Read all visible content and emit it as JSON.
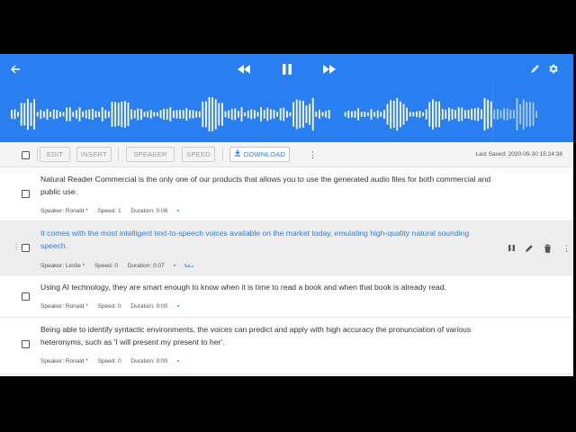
{
  "colors": {
    "header": "#2a7ff0",
    "link_text": "#2a7ff0",
    "accent_dot": "#4caf50",
    "cursor": "#e8524a"
  },
  "header": {
    "back_icon": "arrow-left-icon",
    "rewind_icon": "rewind-icon",
    "pause_icon": "pause-icon",
    "forward_icon": "fast-forward-icon",
    "edit_icon": "pencil-icon",
    "settings_icon": "gear-icon"
  },
  "toolbar": {
    "edit_label": "EDIT",
    "insert_label": "INSERT",
    "speaker_label": "SPEAKER",
    "speed_label": "SPEED",
    "download_label": "DOWNLOAD",
    "last_saved": "Last Saved: 2020-09-30 15:24:38"
  },
  "rows": [
    {
      "text": "Natural Reader Commercial is the only one of our products that allows you to use the generated audio files for both commercial and public use.",
      "speaker": "Speaker: Ronald *",
      "speed": "Speed: 1",
      "duration": "Duration: 0:06"
    },
    {
      "text": "It comes with the most intelligent text-to-speech voices available on the market today, emulating high-quality natural sounding speech.",
      "speaker": "Speaker: Leslie *",
      "speed": "Speed: 0",
      "duration": "Duration: 0:07"
    },
    {
      "text": "Using AI technology, they are smart enough to know when it is time to read a book and when that book is already read.",
      "speaker": "Speaker: Ronald *",
      "speed": "Speed: 0",
      "duration": "Duration: 0:00"
    },
    {
      "text": "Being able to identify syntactic environments, the voices can predict and apply with high accuracy the pronunciation of various heteronyms, such as 'I will present my present to her'.",
      "speaker": "Speaker: Ronald *",
      "speed": "Speed: 0",
      "duration": "Duration: 0:00"
    }
  ]
}
